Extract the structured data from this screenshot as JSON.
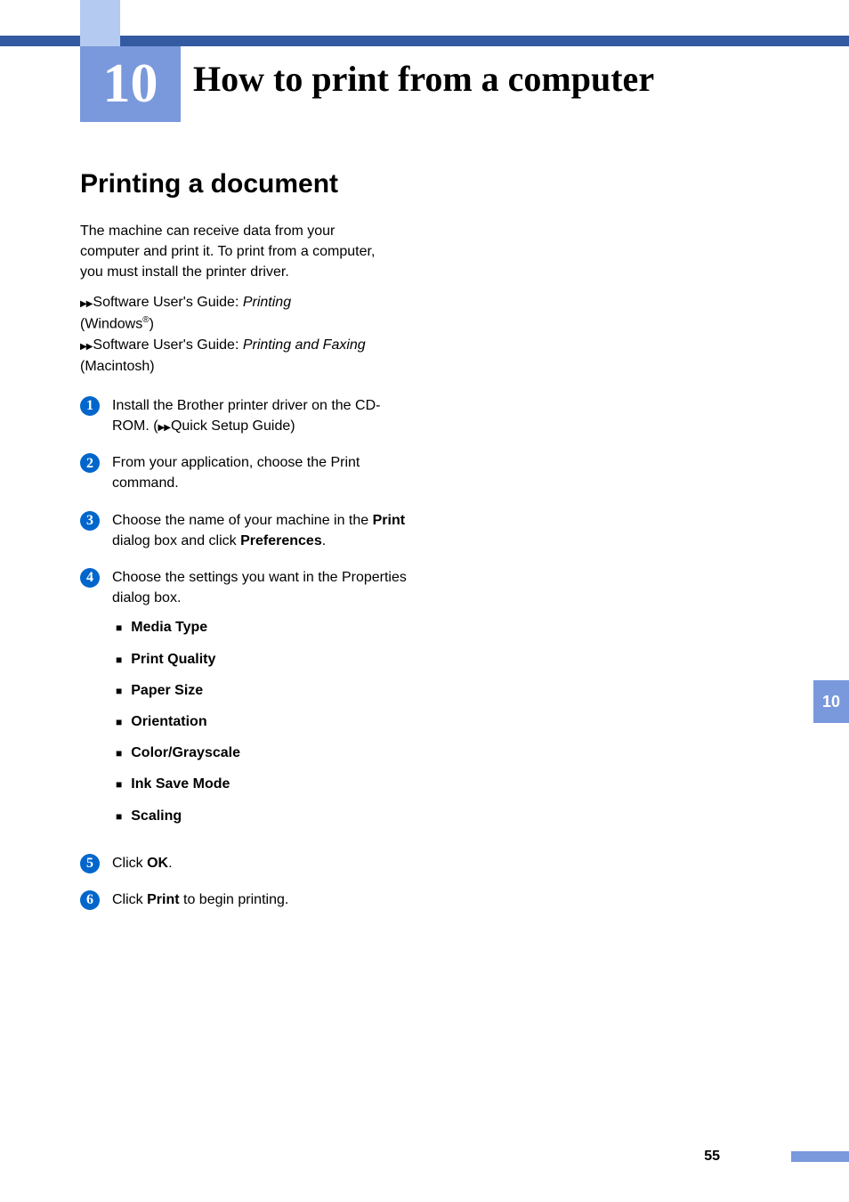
{
  "chapter_number": "10",
  "page_title": "How to print from a computer",
  "section_title": "Printing a document",
  "intro": "The machine can receive data from your computer and print it. To print from a computer, you must install the printer driver.",
  "ref1_prefix": "Software User's Guide: ",
  "ref1_title": "Printing",
  "ref1_paren_open": "(Windows",
  "ref1_sup": "®",
  "ref1_paren_close": ")",
  "ref2_prefix": "Software User's Guide: ",
  "ref2_title": "Printing and Faxing",
  "ref2_suffix": " (Macintosh)",
  "steps": [
    {
      "num": "1",
      "text_before": "Install the Brother printer driver on the CD-ROM. (",
      "text_link": "Quick Setup Guide",
      "text_after": ")"
    },
    {
      "num": "2",
      "text": "From your application, choose the Print command."
    },
    {
      "num": "3",
      "text_before": "Choose the name of your machine in the ",
      "bold1": "Print",
      "text_mid": " dialog box and click ",
      "bold2": "Preferences",
      "text_after": "."
    },
    {
      "num": "4",
      "text": "Choose the settings you want in the Properties dialog box.",
      "settings": [
        "Media Type",
        "Print Quality",
        "Paper Size",
        "Orientation",
        "Color/Grayscale",
        "Ink Save Mode",
        "Scaling"
      ]
    },
    {
      "num": "5",
      "text_before": "Click ",
      "bold1": "OK",
      "text_after": "."
    },
    {
      "num": "6",
      "text_before": "Click ",
      "bold1": "Print",
      "text_after": " to begin printing."
    }
  ],
  "side_tab": "10",
  "page_number": "55"
}
